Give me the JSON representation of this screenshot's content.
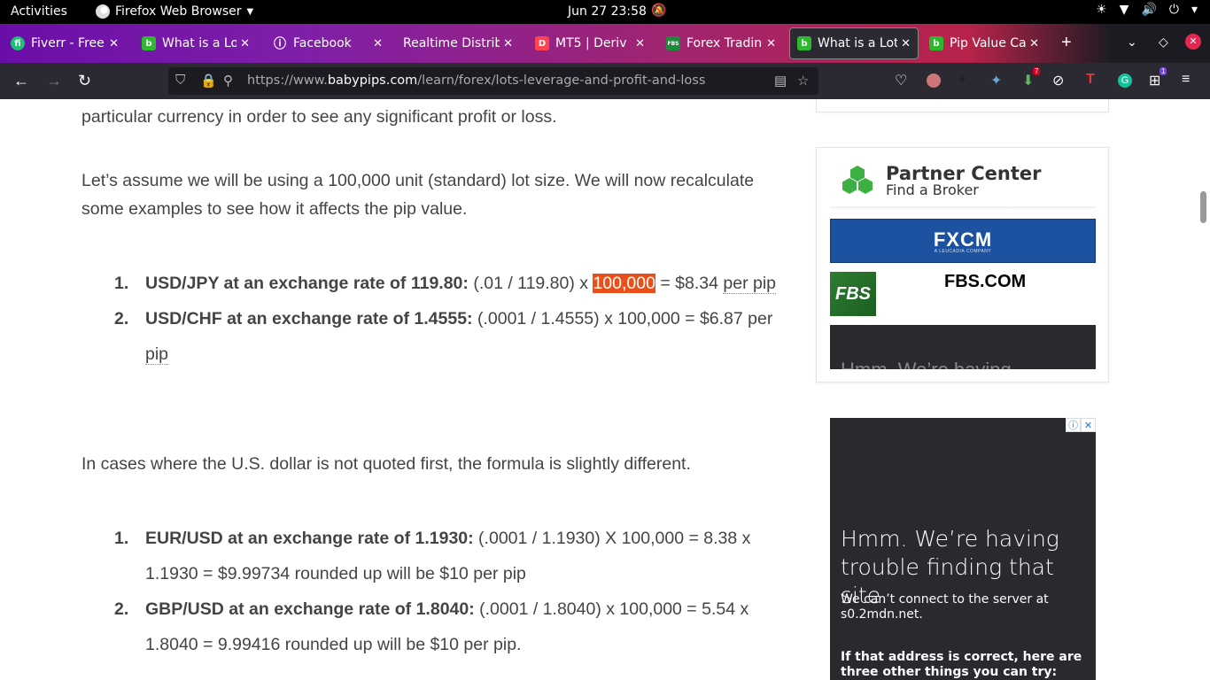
{
  "system_bar": {
    "activities": "Activities",
    "app_name": "Firefox Web Browser",
    "clock": "Jun 27  23:58"
  },
  "tabs": [
    {
      "title": "Fiverr - Freelance",
      "favicon": "fiverr-icon",
      "fav_text": "fi",
      "fav_color": "#1dbf73"
    },
    {
      "title": "What is a Lot in Forex",
      "favicon": "babypips-icon",
      "fav_text": "b",
      "fav_color": "#2eb82e"
    },
    {
      "title": "Facebook",
      "favicon": "info-icon",
      "fav_text": "ⓘ",
      "fav_color": "transparent"
    },
    {
      "title": "Realtime Distribution",
      "favicon": "none",
      "fav_text": "",
      "fav_color": "transparent"
    },
    {
      "title": "MT5 | Deriv",
      "favicon": "deriv-icon",
      "fav_text": "D",
      "fav_color": "#ff444f"
    },
    {
      "title": "Forex Trading",
      "favicon": "fbs-icon",
      "fav_text": "FBS",
      "fav_color": "#1b8a3a"
    },
    {
      "title": "What is a Lot in Forex",
      "favicon": "babypips-icon",
      "fav_text": "b",
      "fav_color": "#2eb82e"
    },
    {
      "title": "Pip Value Calculator",
      "favicon": "babypips-icon",
      "fav_text": "b",
      "fav_color": "#2eb82e"
    }
  ],
  "url": {
    "prefix": "https://www.",
    "domain": "babypips.com",
    "path": "/learn/forex/lots-leverage-and-profit-and-loss"
  },
  "extensions": {
    "download_badge": "7",
    "grid_badge": "1"
  },
  "article": {
    "intro_tail": "particular currency in order to see any significant profit or loss.",
    "lot_para": "Let’s assume we will be using a 100,000 unit (standard) lot size. We will now recalculate some examples to see how it affects the pip value.",
    "list1": [
      {
        "num": "1.",
        "lead": "USD/JPY at an exchange rate of 119.80:",
        "pre": " (.01 / 119.80) x ",
        "highlight": "100,000",
        "post": " = $8.34 ",
        "unit": "per pip"
      },
      {
        "num": "2.",
        "lead": "USD/CHF at an exchange rate of 1.4555:",
        "pre": " (.0001 / 1.4555) x 100,000 = $6.87 per ",
        "unit": "pip"
      }
    ],
    "not_first_para": "In cases where the U.S. dollar is not quoted first, the formula is slightly different.",
    "list2": [
      {
        "num": "1.",
        "lead": "EUR/USD at an exchange rate of 1.1930:",
        "body": " (.0001 / 1.1930) X 100,000 = 8.38 x 1.1930 = $9.99734 rounded up will be $10 per pip"
      },
      {
        "num": "2.",
        "lead": "GBP/USD at an exchange rate of 1.8040:",
        "body": " (.0001 / 1.8040) x 100,000 = 5.54 x 1.8040 = 9.99416 rounded up will be $10 per pip."
      }
    ]
  },
  "sidebar": {
    "partner_title": "Partner Center",
    "partner_sub": "Find a Broker",
    "fxcm": "FXCM",
    "fxcm_sub": "A LEUCADIA COMPANY",
    "fbs_logo": "FBS",
    "fbs_name": "FBS.COM",
    "dark_partial": "Hmm. We’re having"
  },
  "ad": {
    "heading": "Hmm. We’re having trouble finding that site.",
    "message": "We can’t connect to the server at s0.2mdn.net.",
    "bold": "If that address is correct, here are three other things you can try:"
  }
}
